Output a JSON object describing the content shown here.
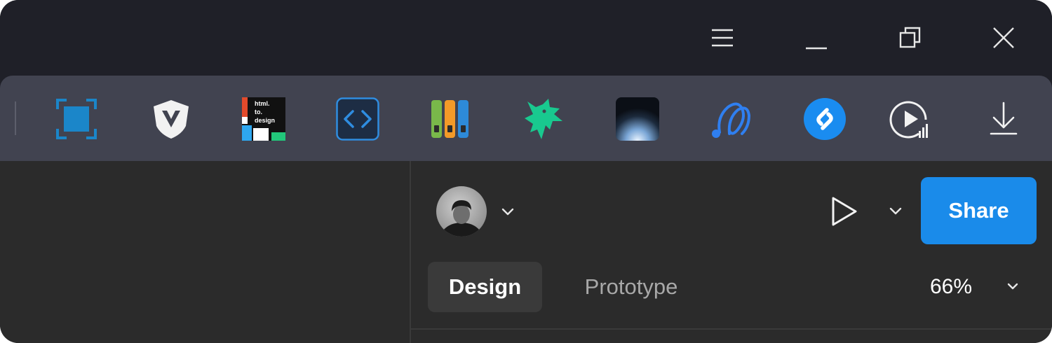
{
  "titlebar": {
    "controls": [
      {
        "icon": "hamburger-menu-icon"
      },
      {
        "icon": "minimize-icon"
      },
      {
        "icon": "restore-icon"
      },
      {
        "icon": "close-icon"
      }
    ]
  },
  "extensions": {
    "items": [
      {
        "icon": "screenshot-capture-icon",
        "color": "#1b86c9"
      },
      {
        "icon": "vivaldi-shield-icon",
        "color": "#ffffff"
      },
      {
        "icon": "html-to-design-icon",
        "label_lines": [
          "html.",
          "to.",
          "design"
        ]
      },
      {
        "icon": "code-brackets-icon",
        "color": "#2f8de0"
      },
      {
        "icon": "binders-library-icon",
        "colors": [
          "#79b84a",
          "#f39a28",
          "#2d8ad8"
        ]
      },
      {
        "icon": "green-creature-icon",
        "color": "#19c98f"
      },
      {
        "icon": "spotlight-gradient-icon"
      },
      {
        "icon": "blue-swirl-icon",
        "color": "#2f7ff0"
      },
      {
        "icon": "shazam-icon",
        "color": "#1a8cf0"
      },
      {
        "icon": "play-stats-icon"
      },
      {
        "icon": "download-icon"
      }
    ]
  },
  "toolbar": {
    "avatar_icon": "user-avatar",
    "play_icon": "play-icon",
    "share_label": "Share",
    "accent_color": "#1a8bea"
  },
  "tabs": [
    {
      "label": "Design",
      "active": true
    },
    {
      "label": "Prototype",
      "active": false
    }
  ],
  "zoom": {
    "value": "66%"
  }
}
